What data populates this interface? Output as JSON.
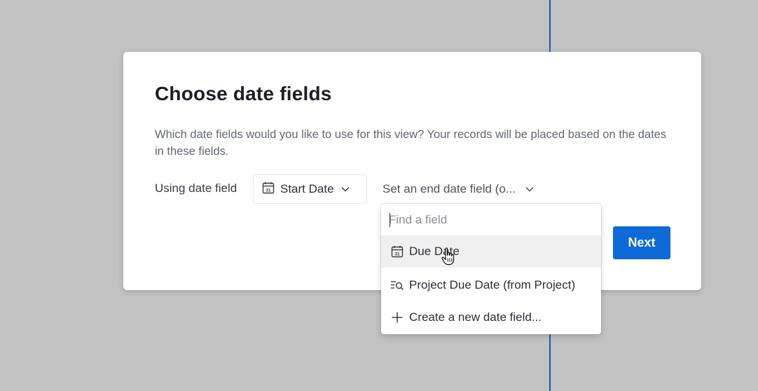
{
  "dialog": {
    "title": "Choose date fields",
    "description": "Which date fields would you like to use for this view? Your records will be placed based on the dates in these fields.",
    "using_label": "Using date field",
    "start_field": {
      "label": "Start Date",
      "icon": "calendar-icon"
    },
    "end_field": {
      "label": "Set an end date field (o...",
      "icon": "chevron-down-icon"
    },
    "next_label": "Next"
  },
  "dropdown": {
    "search_placeholder": "Find a field",
    "options": [
      {
        "label": "Due Date",
        "icon": "calendar-icon",
        "highlighted": true
      },
      {
        "label": "Project Due Date (from Project)",
        "icon": "lookup-icon"
      },
      {
        "label": "Create a new date field...",
        "icon": "plus-icon"
      }
    ]
  },
  "colors": {
    "accent": "#0d6ad6",
    "backdrop": "#c2c2c2",
    "divider_line": "#1f56b4"
  }
}
